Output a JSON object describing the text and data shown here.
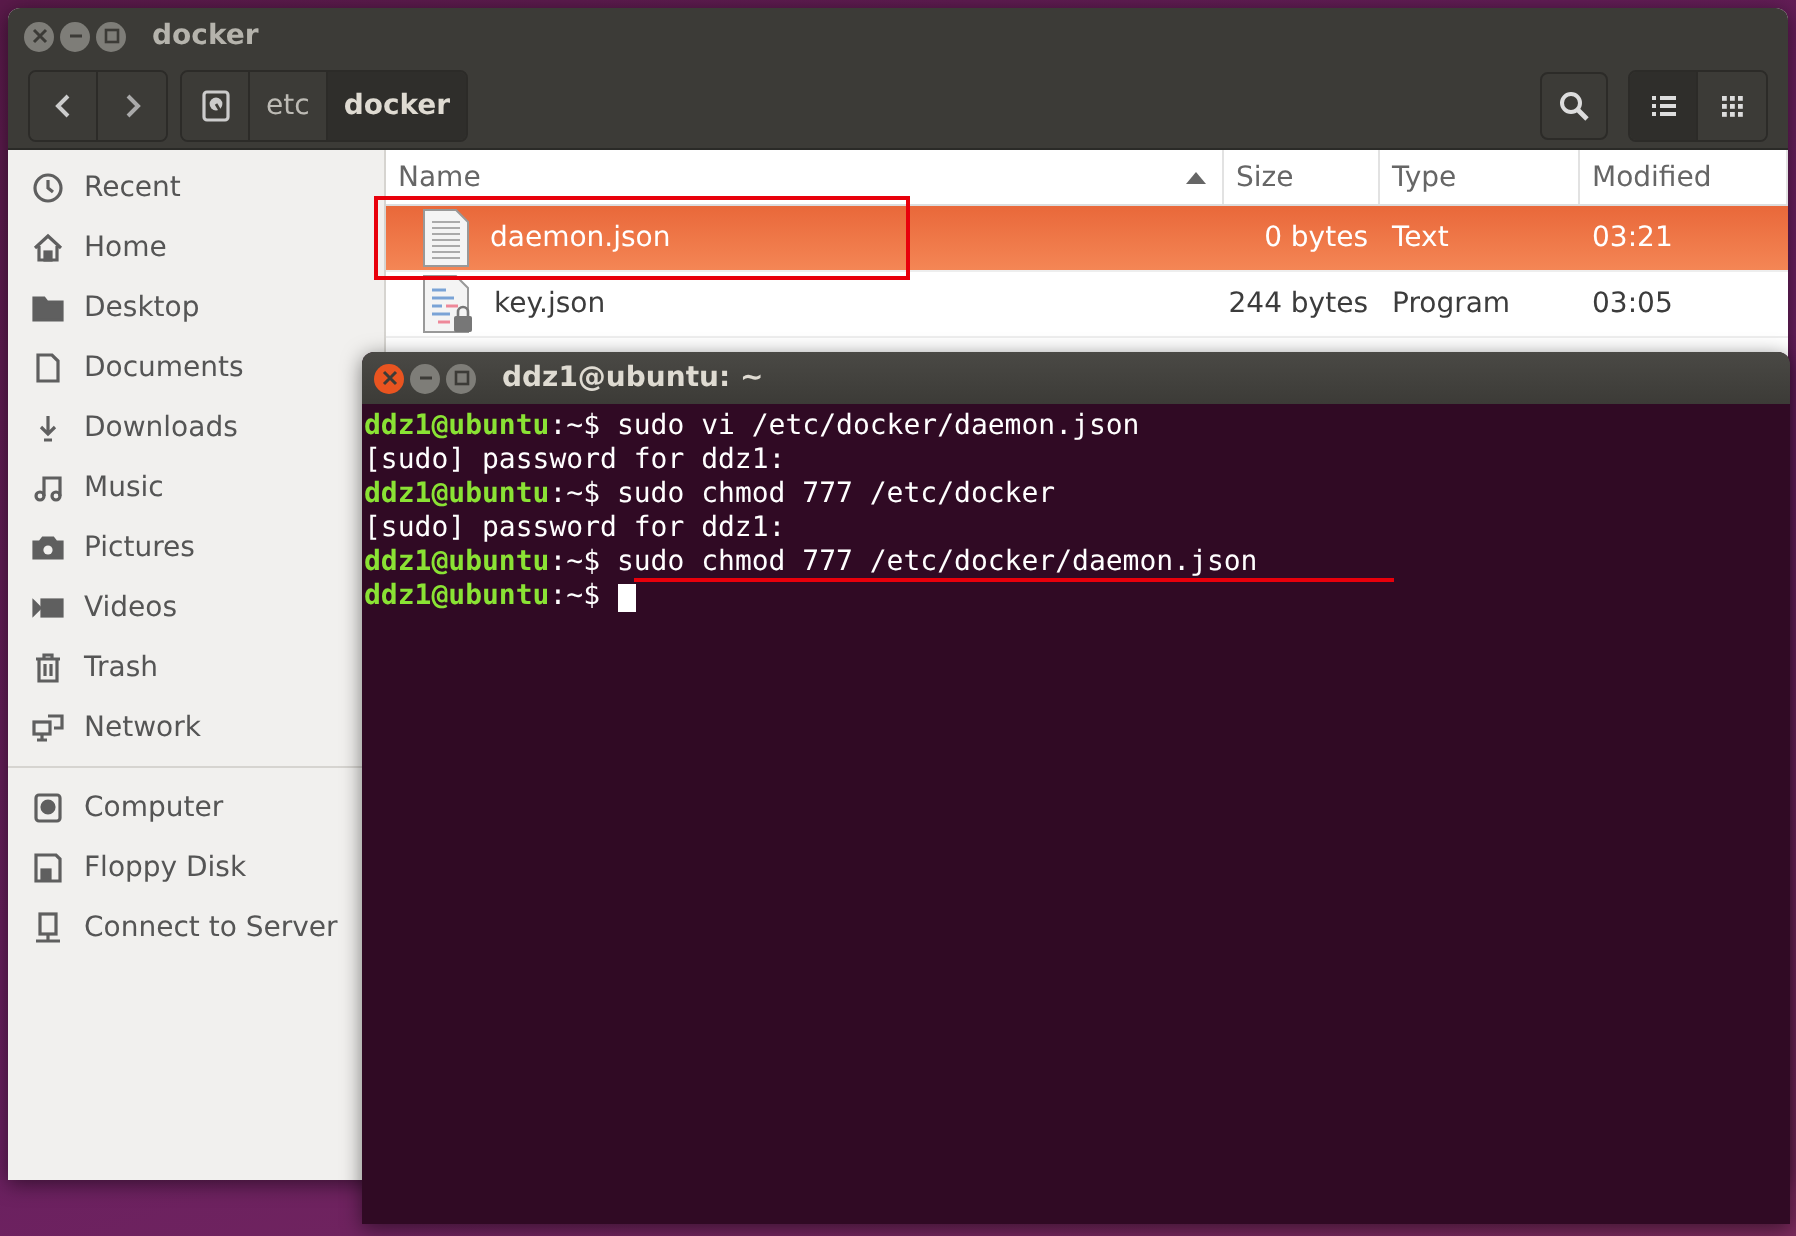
{
  "file_manager": {
    "title": "docker",
    "path": [
      {
        "label": "etc",
        "selected": false
      },
      {
        "label": "docker",
        "selected": true
      }
    ],
    "views": [
      {
        "kind": "list",
        "selected": true
      },
      {
        "kind": "grid",
        "selected": false
      }
    ],
    "sidebar": {
      "places": [
        "Recent",
        "Home",
        "Desktop",
        "Documents",
        "Downloads",
        "Music",
        "Pictures",
        "Videos",
        "Trash",
        "Network"
      ],
      "devices": [
        "Computer",
        "Floppy Disk",
        "Connect to Server"
      ]
    },
    "columns": [
      "Name",
      "Size",
      "Type",
      "Modified"
    ],
    "rows": [
      {
        "name": "daemon.json",
        "size": "0 bytes",
        "type": "Text",
        "modified": "03:21",
        "selected": true,
        "annotated": true,
        "kind": "text"
      },
      {
        "name": "key.json",
        "size": "244 bytes",
        "type": "Program",
        "modified": "03:05",
        "selected": false,
        "annotated": false,
        "kind": "program"
      }
    ]
  },
  "terminal": {
    "title": "ddz1@ubuntu: ~",
    "lines": [
      {
        "kind": "prompt",
        "user": "ddz1@ubuntu",
        "path": ":~$",
        "command": "sudo vi /etc/docker/daemon.json"
      },
      {
        "kind": "output",
        "text": "[sudo] password for ddz1:"
      },
      {
        "kind": "prompt",
        "user": "ddz1@ubuntu",
        "path": ":~$",
        "command": "sudo chmod 777 /etc/docker"
      },
      {
        "kind": "output",
        "text": "[sudo] password for ddz1:"
      },
      {
        "kind": "prompt",
        "user": "ddz1@ubuntu",
        "path": ":~$",
        "command": "sudo chmod 777 /etc/docker/daemon.json",
        "underlined": true
      },
      {
        "kind": "prompt",
        "user": "ddz1@ubuntu",
        "path": ":~$",
        "cursor": true
      }
    ]
  }
}
